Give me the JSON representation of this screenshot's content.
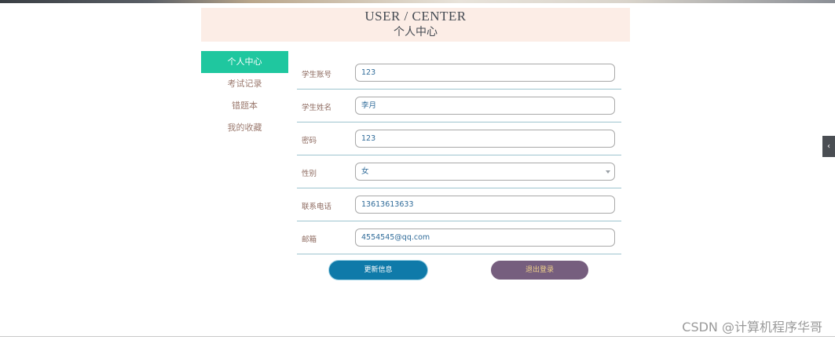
{
  "header": {
    "title_en": "USER / CENTER",
    "title_cn": "个人中心"
  },
  "sidebar": {
    "items": [
      {
        "label": "个人中心",
        "active": true
      },
      {
        "label": "考试记录",
        "active": false
      },
      {
        "label": "错题本",
        "active": false
      },
      {
        "label": "我的收藏",
        "active": false
      }
    ]
  },
  "form": {
    "fields": [
      {
        "label": "学生账号",
        "value": "123"
      },
      {
        "label": "学生姓名",
        "value": "李月"
      },
      {
        "label": "密码",
        "value": "123"
      },
      {
        "label": "性别",
        "value": "女"
      },
      {
        "label": "联系电话",
        "value": "13613613633"
      },
      {
        "label": "邮箱",
        "value": "4554545@qq.com"
      }
    ]
  },
  "buttons": {
    "update_label": "更新信息",
    "logout_label": "退出登录"
  },
  "side_toggle_icon": "chevron-left-icon",
  "watermark": "CSDN @计算机程序华哥",
  "colors": {
    "header_bg": "#fcede6",
    "sidebar_active": "#1fc79f",
    "update_button": "#0f7aa9",
    "logout_button": "#765e7e"
  }
}
